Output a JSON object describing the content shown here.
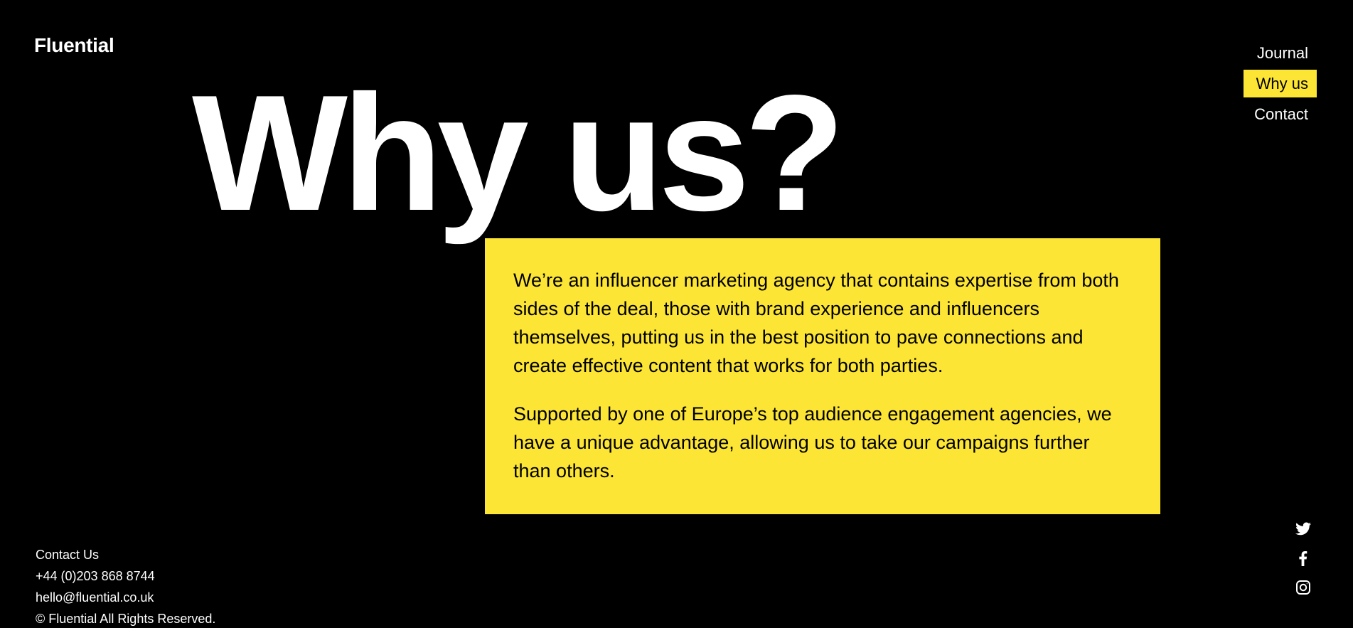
{
  "header": {
    "logo": "Fluential"
  },
  "nav": {
    "items": [
      {
        "label": "Journal"
      },
      {
        "label": "Why us",
        "active": true
      },
      {
        "label": "Contact"
      }
    ]
  },
  "hero": {
    "title": "Why us?"
  },
  "panel": {
    "paragraph_1": "We’re an influencer marketing agency that contains expertise from both sides of the deal, those with brand experience and influencers themselves, putting us in the best position to pave connections and create effective content that works for both parties.",
    "paragraph_2": "Supported by one of Europe’s top audience engagement agencies, we have a unique advantage, allowing us to take our campaigns further than others."
  },
  "footer": {
    "contact_heading": "Contact Us",
    "phone": "+44 (0)203 868 8744",
    "email": "hello@fluential.co.uk",
    "copyright": "© Fluential All Rights Reserved."
  },
  "social": {
    "icons": [
      "twitter-icon",
      "facebook-icon",
      "instagram-icon"
    ]
  },
  "colors": {
    "background": "#000000",
    "accent": "#fce535",
    "text": "#ffffff"
  }
}
